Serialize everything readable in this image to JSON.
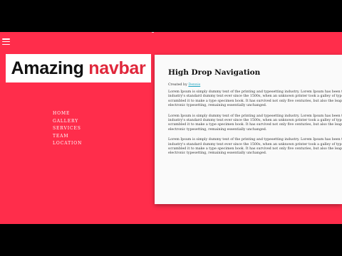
{
  "logo": {
    "word1": "Amazing",
    "word2": "navbar"
  },
  "nav": {
    "items": [
      "HOME",
      "GALLERY",
      "SERVICES",
      "TEAM",
      "LOCATION"
    ]
  },
  "card": {
    "title": "High Drop Navigation",
    "credit_prefix": "Created by",
    "credit_author": "Dennis",
    "paragraphs": [
      "Lorem Ipsum is simply dummy text of the printing and typesetting industry. Lorem Ipsum has been the industry's standard dummy text ever since the 1500s, when an unknown printer took a galley of type and scrambled it to make a type specimen book. It has survived not only five centuries, but also the leap into electronic typesetting, remaining essentially unchanged.",
      "Lorem Ipsum is simply dummy text of the printing and typesetting industry. Lorem Ipsum has been the industry's standard dummy text ever since the 1500s, when an unknown printer took a galley of type and scrambled it to make a type specimen book. It has survived not only five centuries, but also the leap into electronic typesetting, remaining essentially unchanged.",
      "Lorem Ipsum is simply dummy text of the printing and typesetting industry. Lorem Ipsum has been the industry's standard dummy text ever since the 1500s, when an unknown printer took a galley of type and scrambled it to make a type specimen book. It has survived not only five centuries, but also the leap into electronic typesetting, remaining essentially unchanged."
    ]
  },
  "colors": {
    "background": "#ff2d4b",
    "accent": "#e0283c",
    "link": "#1aa3c0"
  },
  "icons": {
    "menu": "hamburger-menu-icon"
  }
}
